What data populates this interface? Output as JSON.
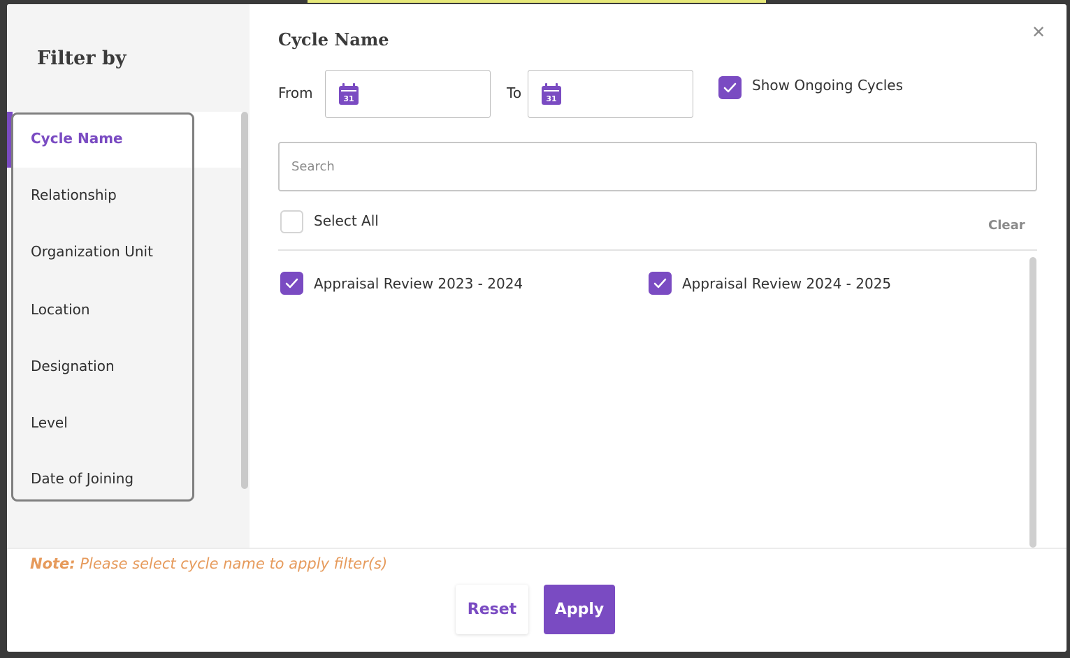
{
  "sidebar": {
    "title": "Filter by",
    "items": [
      {
        "label": "Cycle Name",
        "active": true
      },
      {
        "label": "Relationship",
        "active": false
      },
      {
        "label": "Organization Unit",
        "active": false
      },
      {
        "label": "Location",
        "active": false
      },
      {
        "label": "Designation",
        "active": false
      },
      {
        "label": "Level",
        "active": false
      },
      {
        "label": "Date of Joining",
        "active": false
      }
    ]
  },
  "close_icon": "close-icon",
  "main": {
    "title": "Cycle Name",
    "from_label": "From",
    "to_label": "To",
    "from_value": "",
    "to_value": "",
    "show_ongoing": {
      "label": "Show Ongoing Cycles",
      "checked": true
    },
    "search": {
      "placeholder": "Search",
      "value": ""
    },
    "select_all": {
      "label": "Select All",
      "checked": false
    },
    "clear_label": "Clear",
    "options": [
      {
        "label": "Appraisal Review 2023 - 2024",
        "checked": true
      },
      {
        "label": "Appraisal Review 2024 - 2025",
        "checked": true
      }
    ]
  },
  "footer": {
    "note_prefix": "Note:",
    "note_text": "Please select cycle name to apply filter(s)",
    "reset_label": "Reset",
    "apply_label": "Apply"
  },
  "colors": {
    "accent": "#7a4bc2",
    "note": "#e69a5b"
  }
}
